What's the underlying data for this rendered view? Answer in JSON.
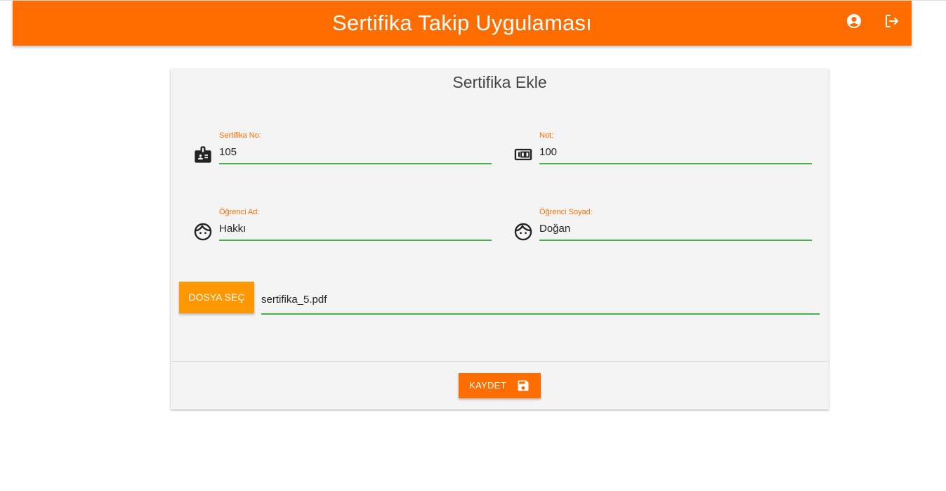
{
  "header": {
    "title": "Sertifika Takip Uygulaması",
    "account_icon": "account-circle-icon",
    "logout_icon": "logout-icon",
    "bg_color": "#ff6d00"
  },
  "form": {
    "title": "Sertifika Ekle",
    "fields": {
      "certificate_no": {
        "label": "Sertifika No:",
        "value": "105",
        "icon": "badge-icon"
      },
      "grade": {
        "label": "Not:",
        "value": "100",
        "icon": "counter-icon"
      },
      "first_name": {
        "label": "Öğrenci Ad:",
        "value": "Hakkı",
        "icon": "face-icon"
      },
      "last_name": {
        "label": "Öğrenci Soyad:",
        "value": "Doğan",
        "icon": "face-icon"
      }
    },
    "file": {
      "button_label": "DOSYA SEÇ",
      "value": "sertifika_5.pdf"
    },
    "save": {
      "label": "KAYDET",
      "icon": "save-icon"
    }
  },
  "colors": {
    "accent": "#ff6d00",
    "file_button": "#ff9800",
    "underline": "#4caf50",
    "card_bg": "#f4f4f4"
  }
}
